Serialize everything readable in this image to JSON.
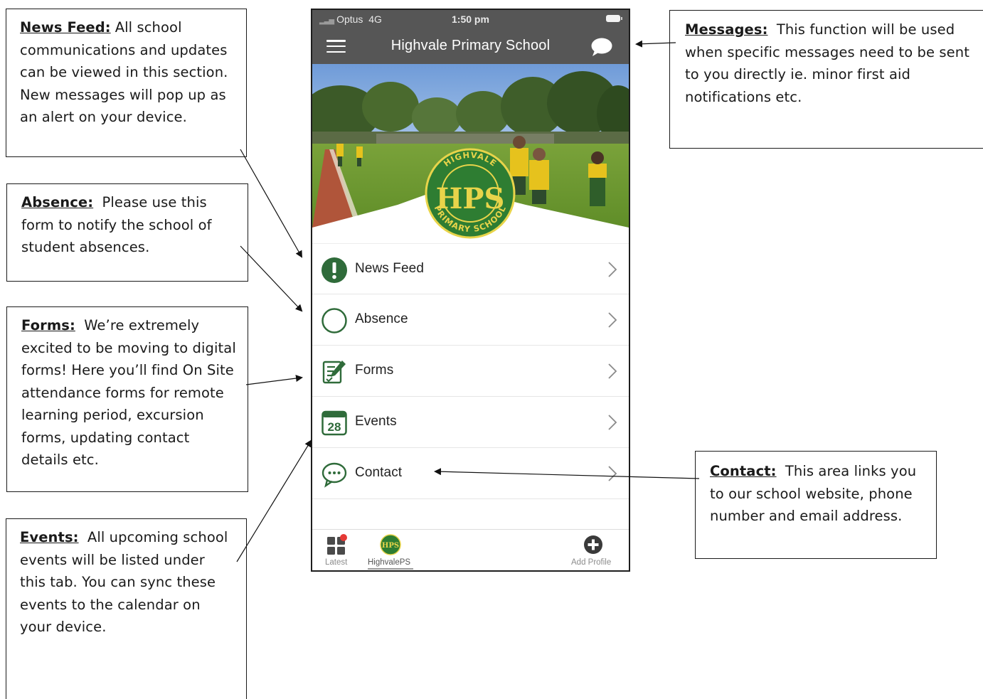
{
  "callouts": {
    "news_feed": {
      "heading": "News Feed:",
      "body": "All school communications and updates can be viewed in this section. New messages will pop up as an alert on your device."
    },
    "absence": {
      "heading": "Absence:",
      "body": "Please use this form to notify the school of student absences."
    },
    "forms": {
      "heading": "Forms:",
      "body": "We’re extremely excited to be moving to digital forms! Here you’ll find On Site attendance forms for remote learning period, excursion forms, updating contact details etc."
    },
    "events": {
      "heading": "Events:",
      "body": "All upcoming school events will be listed under this tab. You can sync these events to the calendar on your device."
    },
    "messages": {
      "heading": "Messages:",
      "body": "This function will be used when specific messages need to be sent to you directly ie. minor first aid notifications etc."
    },
    "contact": {
      "heading": "Contact:",
      "body": "This area links you to our school website, phone number and email address."
    }
  },
  "phone": {
    "status_bar": {
      "carrier": "Optus",
      "network": "4G",
      "time": "1:50 pm"
    },
    "nav": {
      "title": "Highvale Primary School",
      "menu_icon": "hamburger-icon",
      "messages_icon": "chat-bubble-icon"
    },
    "logo": {
      "text_top": "HIGHVALE",
      "text_center": "HPS",
      "text_bottom": "PRIMARY SCHOOL"
    },
    "menu_items": [
      {
        "label": "News Feed",
        "icon": "exclamation-circle-icon"
      },
      {
        "label": "Absence",
        "icon": "circle-outline-icon"
      },
      {
        "label": "Forms",
        "icon": "form-edit-icon"
      },
      {
        "label": "Events",
        "icon": "calendar-icon",
        "icon_text": "28"
      },
      {
        "label": "Contact",
        "icon": "speech-bubble-dots-icon"
      }
    ],
    "tabs": [
      {
        "label": "Latest",
        "icon": "grid-icon"
      },
      {
        "label": "HighvalePS",
        "icon": "school-logo-icon"
      },
      {
        "label": "Add Profile",
        "icon": "plus-circle-icon"
      }
    ]
  },
  "colors": {
    "nav_bg": "#565656",
    "icon_green": "#2f6b3a",
    "logo_green": "#2e7d32",
    "logo_yellow": "#e8d44a",
    "notification_red": "#e53935"
  }
}
